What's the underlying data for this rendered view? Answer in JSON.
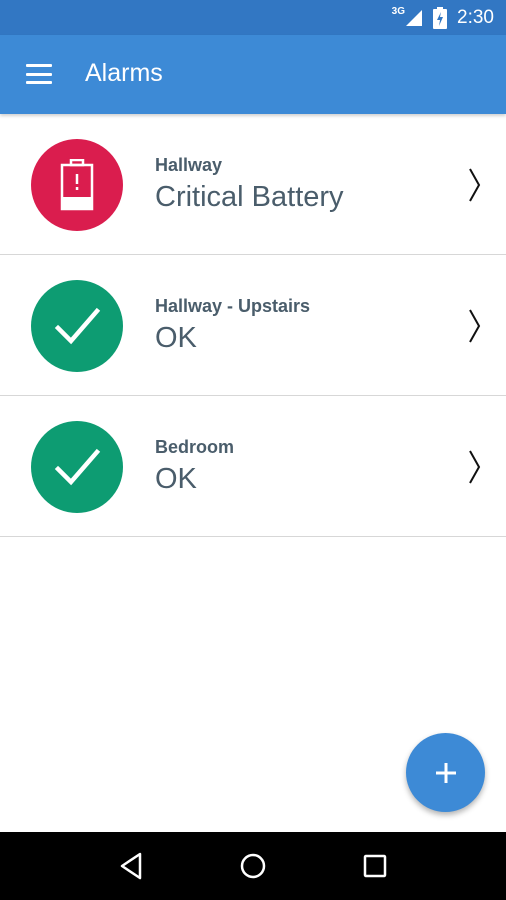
{
  "status_bar": {
    "network": "3G",
    "time": "2:30"
  },
  "app_bar": {
    "title": "Alarms"
  },
  "alarms": [
    {
      "name": "Hallway",
      "state": "Critical Battery",
      "status_icon": "battery-alert-icon",
      "color": "#da1d4e"
    },
    {
      "name": "Hallway - Upstairs",
      "state": "OK",
      "status_icon": "checkmark-icon",
      "color": "#0d9c72"
    },
    {
      "name": "Bedroom",
      "state": "OK",
      "status_icon": "checkmark-icon",
      "color": "#0d9c72"
    }
  ],
  "colors": {
    "status_bar": "#3277c3",
    "app_bar": "#3d8ad6",
    "critical": "#da1d4e",
    "ok": "#0d9c72",
    "text": "#4a5d6b"
  },
  "fab": {
    "icon": "plus-icon"
  },
  "nav": {
    "back_icon": "back-icon",
    "home_icon": "home-icon",
    "recents_icon": "recents-icon"
  }
}
